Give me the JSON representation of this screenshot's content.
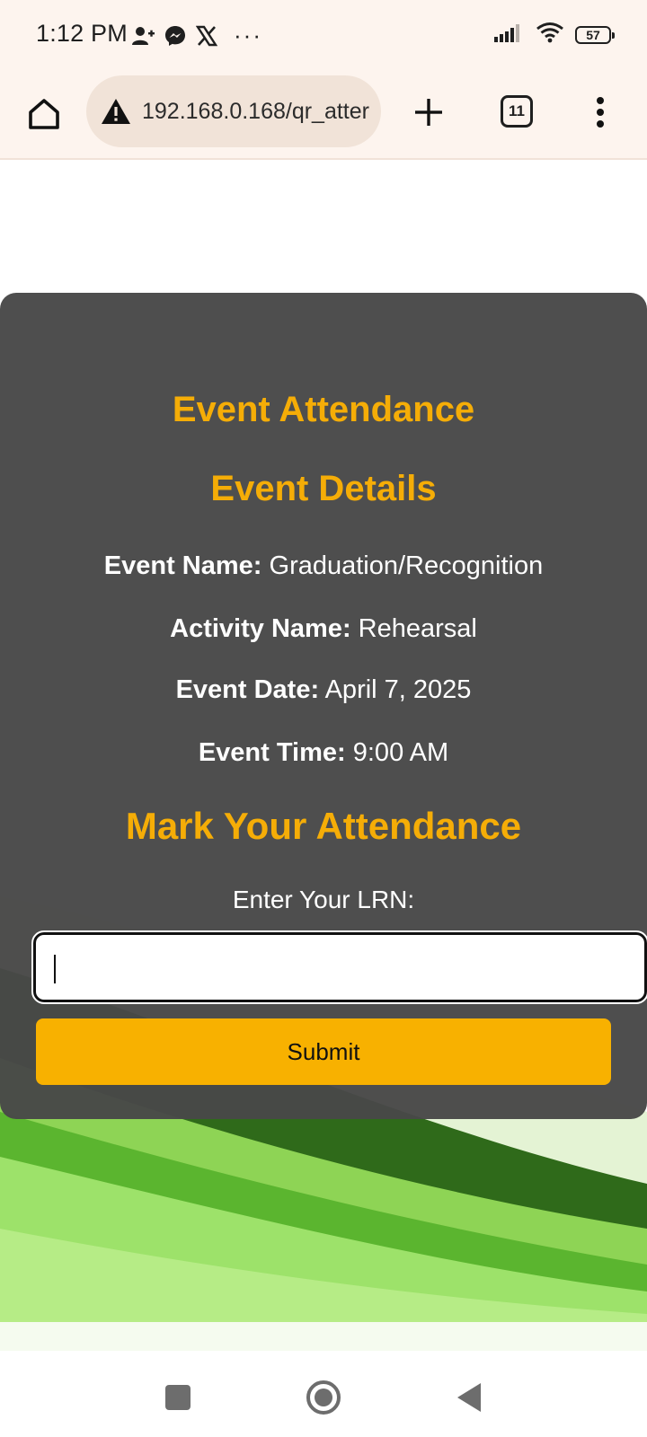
{
  "status_bar": {
    "time": "1:12 PM",
    "notification_icons": [
      "add-contact-icon",
      "messenger-icon",
      "x-icon",
      "more-dots-icon"
    ],
    "more_dots": "···",
    "battery_level": "57"
  },
  "browser": {
    "url": "192.168.0.168/qr_atter",
    "tab_count": "11"
  },
  "page": {
    "title": "Event Attendance",
    "subtitle": "Event Details",
    "event_name_label": "Event Name:",
    "event_name_value": "Graduation/Recognition",
    "activity_name_label": "Activity Name:",
    "activity_name_value": "Rehearsal",
    "event_date_label": "Event Date:",
    "event_date_value": "April 7, 2025",
    "event_time_label": "Event Time:",
    "event_time_value": "9:00 AM",
    "mark_heading": "Mark Your Attendance",
    "lrn_label": "Enter Your LRN:",
    "lrn_value": "",
    "submit_label": "Submit"
  },
  "colors": {
    "accent": "#f5ad07",
    "button": "#f8b100",
    "card": "#484848",
    "toolbar": "#fdf4ee"
  }
}
